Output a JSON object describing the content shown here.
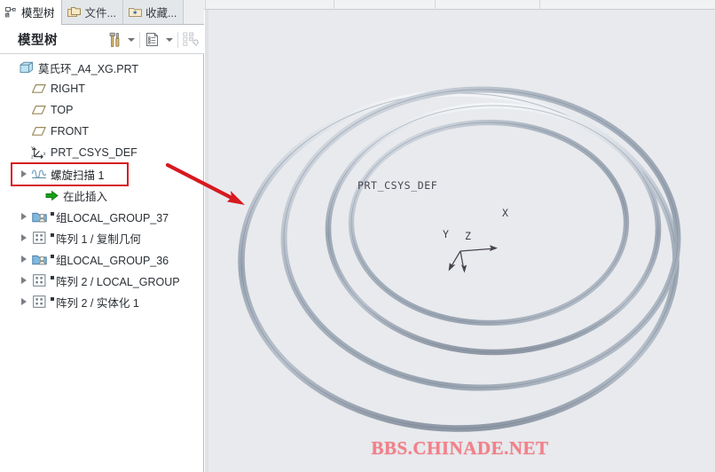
{
  "window": {
    "app_background": "#ffffff",
    "viewport_background": "#e8eaed",
    "accent_red": "#d71920"
  },
  "tabs": [
    {
      "label": "模型树",
      "icon": "model-tree-icon",
      "active": true
    },
    {
      "label": "文件...",
      "icon": "folders-icon",
      "active": false
    },
    {
      "label": "收藏...",
      "icon": "favorites-folder-icon",
      "active": false
    }
  ],
  "panel": {
    "title": "模型树",
    "tools": [
      {
        "name": "settings-tools-button",
        "icon": "hammer-screwdriver-icon"
      },
      {
        "name": "settings-tools-dropdown",
        "icon": "chevron-down-icon"
      },
      {
        "name": "display-options-button",
        "icon": "list-document-icon"
      },
      {
        "name": "display-options-dropdown",
        "icon": "chevron-down-icon"
      },
      {
        "name": "tree-filters-button",
        "icon": "tree-filter-disabled-icon"
      }
    ]
  },
  "tree": {
    "nodes": [
      {
        "label": "莫氏环_A4_XG.PRT",
        "icon": "part-cube-icon",
        "indent": 0,
        "expander": false,
        "highlight": false
      },
      {
        "label": "RIGHT",
        "icon": "datum-plane-icon",
        "indent": 1,
        "expander": false,
        "highlight": false
      },
      {
        "label": "TOP",
        "icon": "datum-plane-icon",
        "indent": 1,
        "expander": false,
        "highlight": false
      },
      {
        "label": "FRONT",
        "icon": "datum-plane-icon",
        "indent": 1,
        "expander": false,
        "highlight": false
      },
      {
        "label": "PRT_CSYS_DEF",
        "icon": "coordinate-system-icon",
        "indent": 1,
        "expander": false,
        "highlight": false
      },
      {
        "label": "螺旋扫描 1",
        "icon": "helical-sweep-icon",
        "indent": 1,
        "expander": true,
        "highlight": true
      },
      {
        "label": "在此插入",
        "icon": "insert-here-arrow-icon",
        "indent": 2,
        "expander": false,
        "highlight": false
      },
      {
        "label": "组LOCAL_GROUP_37",
        "icon": "group-icon",
        "indent": 1,
        "expander": true,
        "highlight": false,
        "prefix_mark": true
      },
      {
        "label": "阵列 1 / 复制几何",
        "icon": "pattern-icon",
        "indent": 1,
        "expander": true,
        "highlight": false,
        "prefix_mark": true
      },
      {
        "label": "组LOCAL_GROUP_36",
        "icon": "group-icon",
        "indent": 1,
        "expander": true,
        "highlight": false,
        "prefix_mark": true
      },
      {
        "label": "阵列 2 / LOCAL_GROUP",
        "icon": "pattern-icon",
        "indent": 1,
        "expander": true,
        "highlight": false,
        "prefix_mark": true
      },
      {
        "label": "阵列 2 / 实体化 1",
        "icon": "pattern-icon",
        "indent": 1,
        "expander": true,
        "highlight": false,
        "prefix_mark": true
      }
    ]
  },
  "viewport": {
    "csys_label": "PRT_CSYS_DEF",
    "axes": [
      {
        "letter": "X"
      },
      {
        "letter": "Y"
      },
      {
        "letter": "Z"
      }
    ],
    "model_name": "helical-sweep-rings"
  },
  "watermark": {
    "text": "BBS.CHINADE.NET",
    "color": "#f2808a"
  },
  "annotation": {
    "arrow_color": "#d71920",
    "points_to": "viewport-model"
  }
}
